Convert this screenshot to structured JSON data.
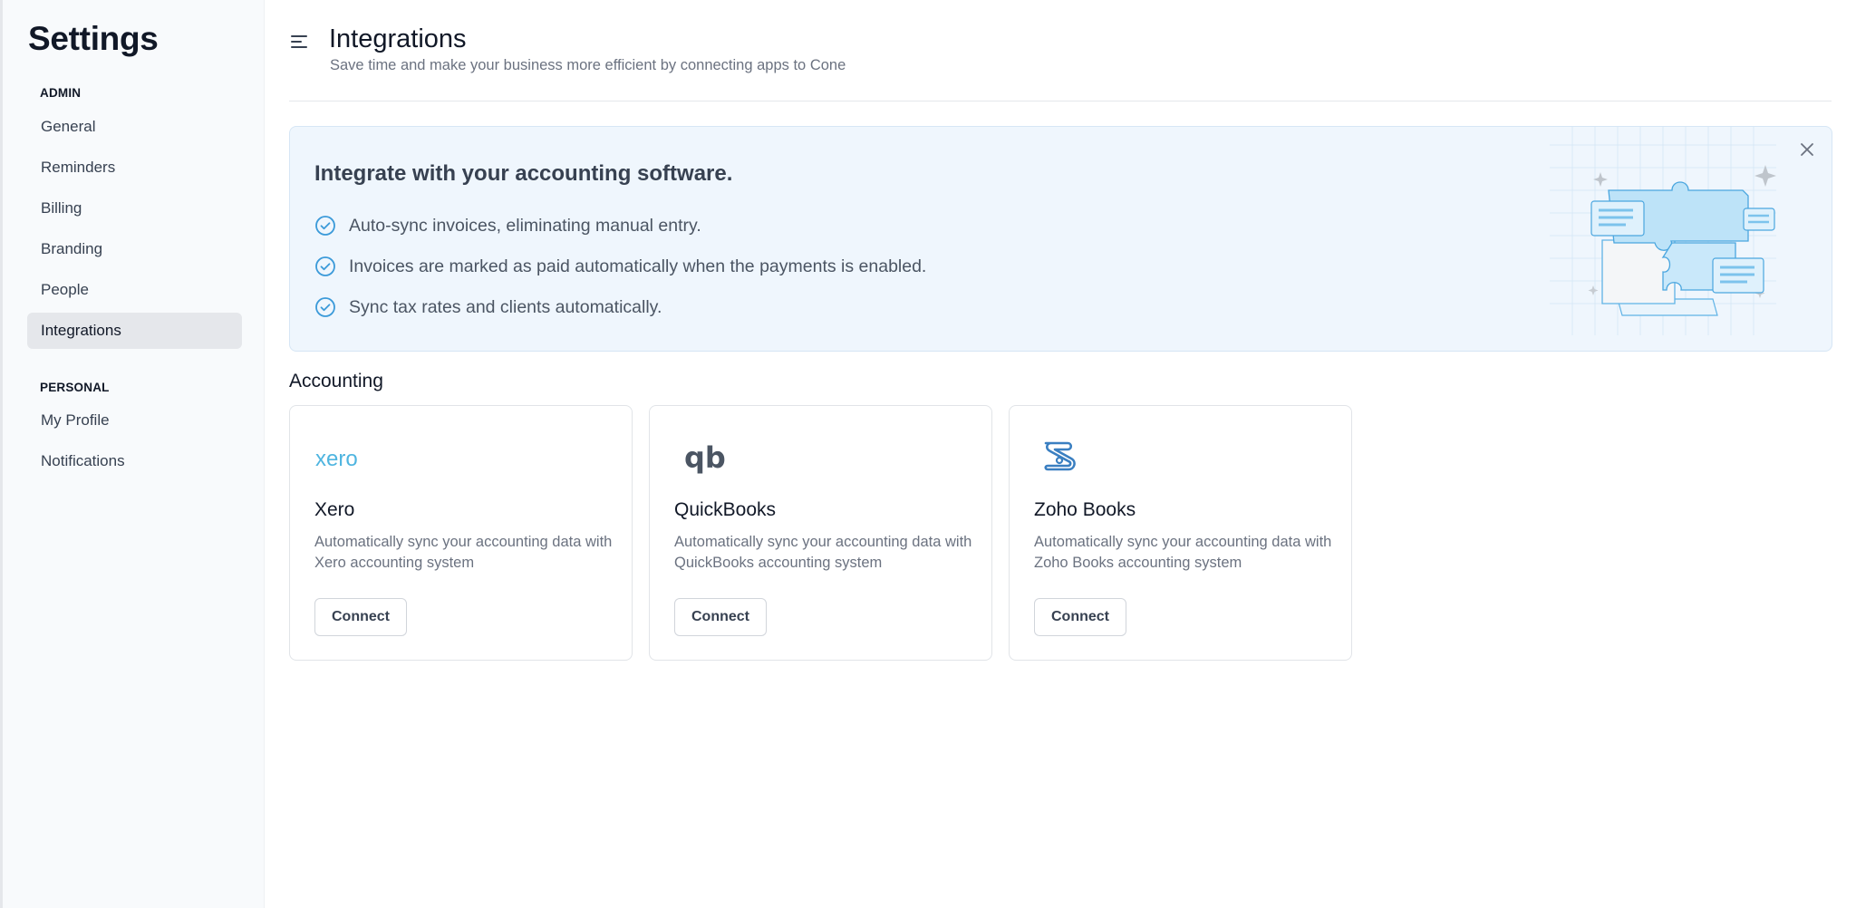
{
  "sidebar": {
    "title": "Settings",
    "admin_label": "ADMIN",
    "admin_items": [
      {
        "label": "General"
      },
      {
        "label": "Reminders"
      },
      {
        "label": "Billing"
      },
      {
        "label": "Branding"
      },
      {
        "label": "People"
      },
      {
        "label": "Integrations",
        "active": true
      }
    ],
    "personal_label": "PERSONAL",
    "personal_items": [
      {
        "label": "My Profile"
      },
      {
        "label": "Notifications"
      }
    ]
  },
  "header": {
    "title": "Integrations",
    "subtitle": "Save time and make your business more efficient by connecting apps to Cone"
  },
  "banner": {
    "title": "Integrate with your accounting software.",
    "benefits": [
      "Auto-sync invoices, eliminating manual entry.",
      "Invoices are marked as paid automatically when the payments is enabled.",
      "Sync tax rates and clients automatically."
    ]
  },
  "accounting": {
    "heading": "Accounting",
    "cards": [
      {
        "name": "Xero",
        "logo_text": "xero",
        "description": "Automatically sync your accounting data with Xero accounting system",
        "button": "Connect"
      },
      {
        "name": "QuickBooks",
        "logo_text": "qb",
        "description": "Automatically sync your accounting data with QuickBooks accounting system",
        "button": "Connect"
      },
      {
        "name": "Zoho Books",
        "logo_text": "",
        "description": "Automatically sync your accounting data with Zoho Books accounting system",
        "button": "Connect"
      }
    ]
  },
  "colors": {
    "accent": "#3b9ad9",
    "banner_bg": "#eff6fd",
    "active_nav_bg": "#e5e7eb",
    "xero_blue": "#4fb5e0",
    "zoho_blue": "#3a7fc1"
  }
}
